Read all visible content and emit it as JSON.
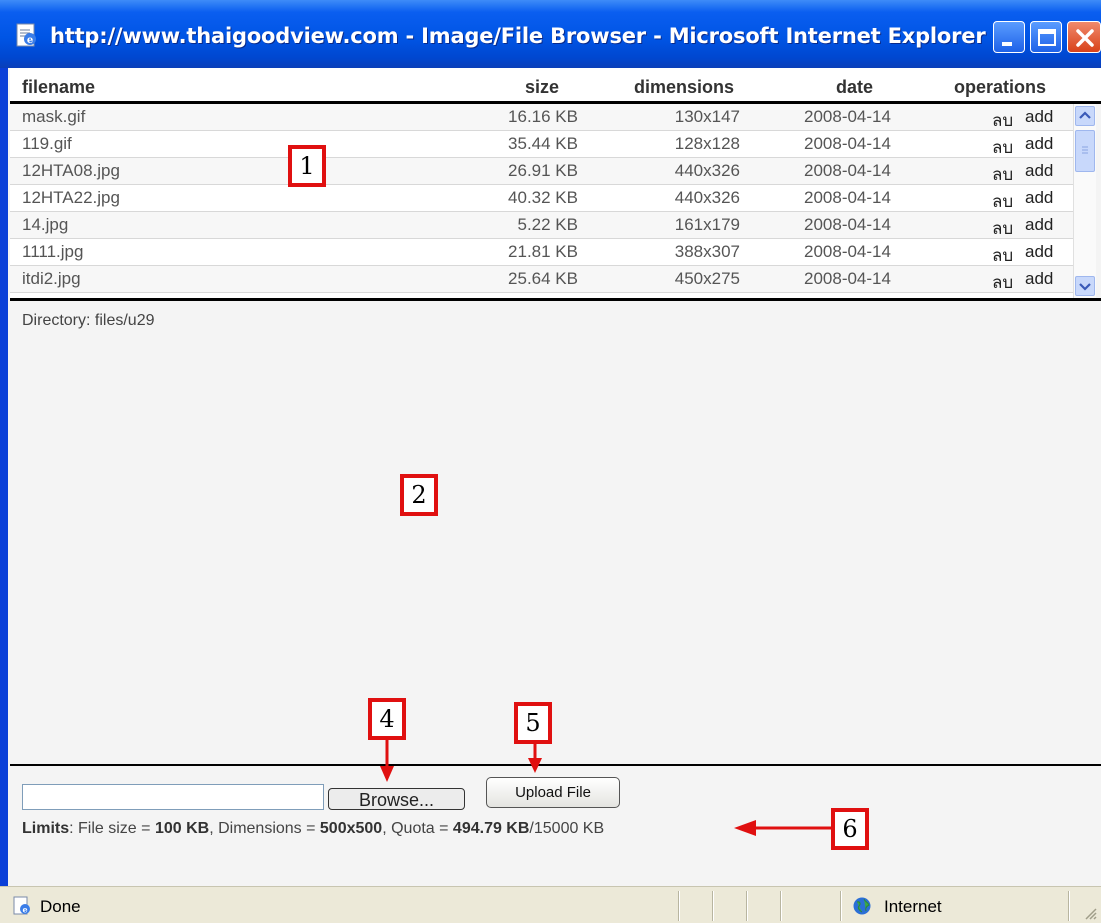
{
  "window": {
    "title": "http://www.thaigoodview.com - Image/File Browser - Microsoft Internet Explorer",
    "icon": "ie-page-icon",
    "controls": [
      "minimize-icon",
      "maximize-icon",
      "close-icon"
    ]
  },
  "table": {
    "headers": {
      "filename": "filename",
      "size": "size",
      "dimensions": "dimensions",
      "date": "date",
      "operations": "operations"
    },
    "rows": [
      {
        "filename": "mask.gif",
        "size": "16.16 KB",
        "dimensions": "130x147",
        "date": "2008-04-14",
        "delete": "ลบ",
        "add": "add"
      },
      {
        "filename": "119.gif",
        "size": "35.44 KB",
        "dimensions": "128x128",
        "date": "2008-04-14",
        "delete": "ลบ",
        "add": "add"
      },
      {
        "filename": "12HTA08.jpg",
        "size": "26.91 KB",
        "dimensions": "440x326",
        "date": "2008-04-14",
        "delete": "ลบ",
        "add": "add"
      },
      {
        "filename": "12HTA22.jpg",
        "size": "40.32 KB",
        "dimensions": "440x326",
        "date": "2008-04-14",
        "delete": "ลบ",
        "add": "add"
      },
      {
        "filename": "14.jpg",
        "size": "5.22 KB",
        "dimensions": "161x179",
        "date": "2008-04-14",
        "delete": "ลบ",
        "add": "add"
      },
      {
        "filename": "1111.jpg",
        "size": "21.81 KB",
        "dimensions": "388x307",
        "date": "2008-04-14",
        "delete": "ลบ",
        "add": "add"
      },
      {
        "filename": "itdi2.jpg",
        "size": "25.64 KB",
        "dimensions": "450x275",
        "date": "2008-04-14",
        "delete": "ลบ",
        "add": "add"
      }
    ]
  },
  "directory": "Directory: files/u29",
  "upload": {
    "file_input_value": "",
    "browse_label": "Browse...",
    "upload_label": "Upload File"
  },
  "limits": {
    "label": "Limits",
    "file_size_label": ": File size = ",
    "file_size": "100 KB",
    "dimensions_label": ", Dimensions = ",
    "dimensions": "500x500",
    "quota_label": ", Quota = ",
    "quota_used": "494.79 KB",
    "quota_total": "/15000 KB"
  },
  "statusbar": {
    "status": "Done",
    "zone": "Internet"
  },
  "annotations": [
    "1",
    "2",
    "4",
    "5",
    "6"
  ],
  "colors": {
    "titlebar": "#0055e5",
    "annotation_red": "#e01010",
    "statusbar": "#ece9d8"
  }
}
